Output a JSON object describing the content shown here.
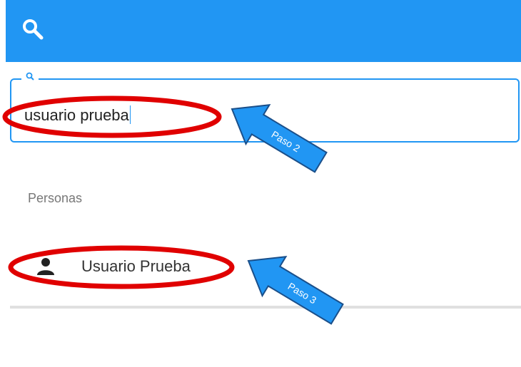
{
  "header": {
    "icon": "search-icon",
    "color": "#2196f3"
  },
  "search": {
    "value": "usuario prueba",
    "legend_icon": "search-icon"
  },
  "results": {
    "section_title": "Personas",
    "items": [
      {
        "icon": "person-icon",
        "label": "Usuario Prueba"
      }
    ]
  },
  "annotations": {
    "step2": "Paso 2",
    "step3": "Paso 3",
    "ellipse_color": "#e00000",
    "arrow_color": "#2196f3"
  }
}
